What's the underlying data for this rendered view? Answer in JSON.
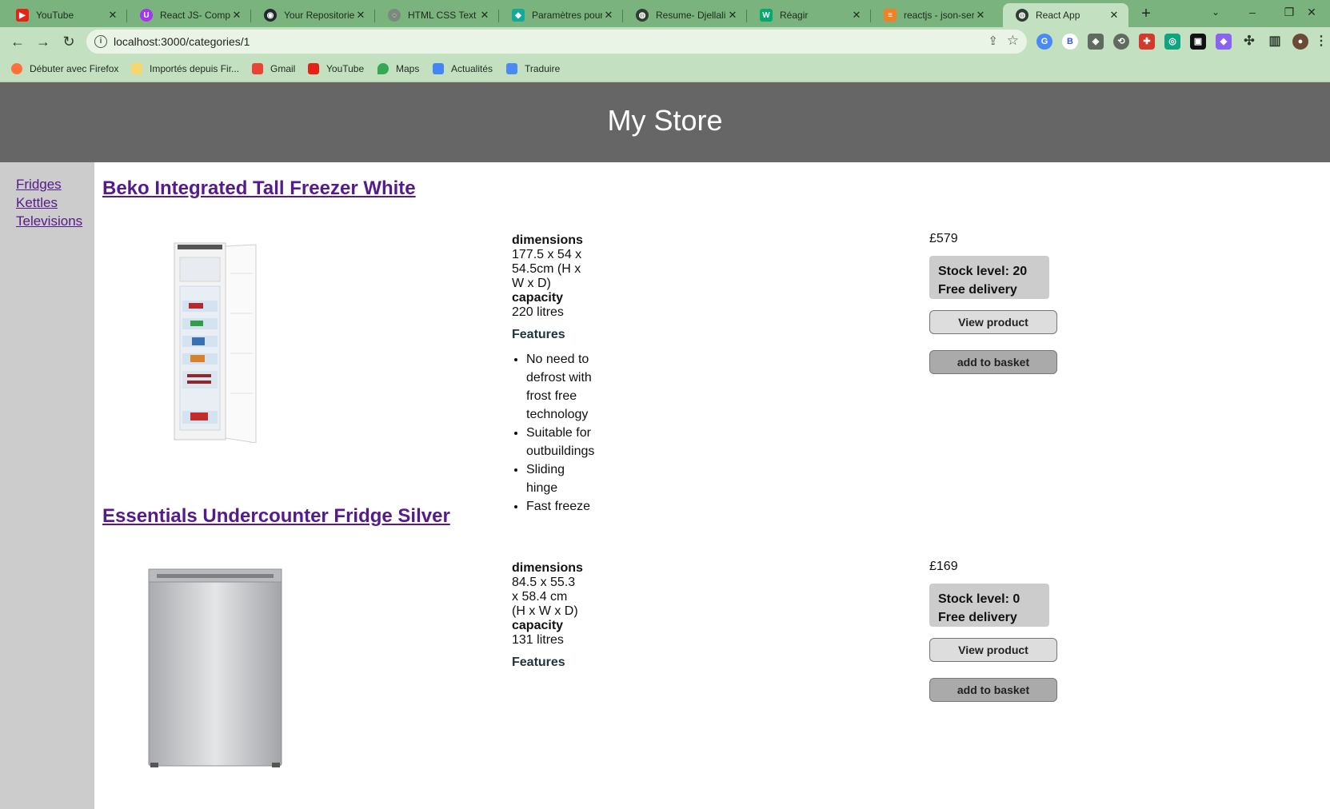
{
  "browser": {
    "tabs": [
      {
        "title": "YouTube",
        "icon": "youtube-icon",
        "color": "#e62117",
        "glyph": "▶"
      },
      {
        "title": "React JS- Comple",
        "icon": "udemy-icon",
        "color": "#a435f0",
        "glyph": "U"
      },
      {
        "title": "Your Repositories",
        "icon": "github-icon",
        "color": "#24292f",
        "glyph": "◉"
      },
      {
        "title": "HTML CSS Text St",
        "icon": "globe-icon",
        "color": "#7b8a7c",
        "glyph": "◌"
      },
      {
        "title": "Paramètres pour",
        "icon": "diamond-icon",
        "color": "#12a99b",
        "glyph": "◆"
      },
      {
        "title": "Resume- Djellali",
        "icon": "globe-icon",
        "color": "#2e3d2f",
        "glyph": "◍"
      },
      {
        "title": "Réagir",
        "icon": "w3-icon",
        "color": "#04aa6d",
        "glyph": "W"
      },
      {
        "title": "reactjs - json-ser",
        "icon": "stackoverflow-icon",
        "color": "#f48024",
        "glyph": "≡"
      },
      {
        "title": "React App",
        "icon": "globe-icon",
        "color": "#2e3d2f",
        "glyph": "◍"
      }
    ],
    "url": "localhost:3000/categories/1",
    "bookmarks": [
      {
        "label": "Débuter avec Firefox",
        "icon": "firefox-icon",
        "color": "#ff7139"
      },
      {
        "label": "Importés depuis Fir...",
        "icon": "folder-icon",
        "color": "#f5d76e"
      },
      {
        "label": "Gmail",
        "icon": "gmail-icon",
        "color": "#ea4335"
      },
      {
        "label": "YouTube",
        "icon": "youtube-icon",
        "color": "#e62117"
      },
      {
        "label": "Maps",
        "icon": "maps-icon",
        "color": "#34a853"
      },
      {
        "label": "Actualités",
        "icon": "news-icon",
        "color": "#4285f4"
      },
      {
        "label": "Traduire",
        "icon": "translate-icon",
        "color": "#4a8af4"
      }
    ]
  },
  "store": {
    "title": "My Store",
    "categories": [
      "Fridges",
      "Kettles",
      "Televisions"
    ],
    "labels": {
      "dimensions": "dimensions",
      "capacity": "capacity",
      "features": "Features",
      "view": "View product",
      "add": "add to basket"
    },
    "products": [
      {
        "name": "Beko Integrated Tall Freezer White",
        "dimensions": "177.5 x 54 x 54.5cm (H x W x D)",
        "capacity": "220 litres",
        "features": [
          "No need to defrost with frost free technology",
          "Suitable for outbuildings",
          "Sliding hinge",
          "Fast freeze"
        ],
        "price": "£579",
        "stock": "Stock level: 20",
        "delivery": "Free delivery"
      },
      {
        "name": "Essentials Undercounter Fridge Silver",
        "dimensions": "84.5 x 55.3 x 58.4 cm (H x W x D)",
        "capacity": "131 litres",
        "features": [],
        "price": "£169",
        "stock": "Stock level: 0",
        "delivery": "Free delivery"
      }
    ]
  }
}
